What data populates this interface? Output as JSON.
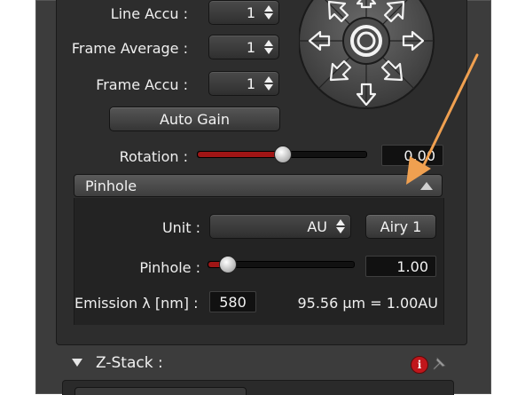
{
  "acquisition": {
    "line_accu": {
      "label": "Line Accu :",
      "value": "1"
    },
    "frame_average": {
      "label": "Frame Average :",
      "value": "1"
    },
    "frame_accu": {
      "label": "Frame Accu :",
      "value": "1"
    },
    "auto_gain_label": "Auto Gain",
    "rotation": {
      "label": "Rotation :",
      "value": "0.00",
      "slider_fraction": 0.5
    }
  },
  "pinhole_section": {
    "title": "Pinhole",
    "unit": {
      "label": "Unit :",
      "value": "AU"
    },
    "airy_button_label": "Airy 1",
    "pinhole": {
      "label": "Pinhole :",
      "value": "1.00",
      "slider_fraction": 0.13
    },
    "emission": {
      "label": "Emission λ [nm] :",
      "value": "580"
    },
    "readout": "95.56 µm = 1.00AU"
  },
  "zstack": {
    "title": "Z-Stack :"
  },
  "colors": {
    "slider_fill": "#a01515",
    "annotation_arrow": "#f0a050",
    "info_badge": "#c0161b"
  },
  "icons": {
    "scan_pad": "directional-pad-icon",
    "collapse": "triangle-up-icon",
    "expand": "triangle-down-icon",
    "info": "info-icon",
    "pin": "pin-icon",
    "annotation": "annotation-arrow-icon"
  }
}
